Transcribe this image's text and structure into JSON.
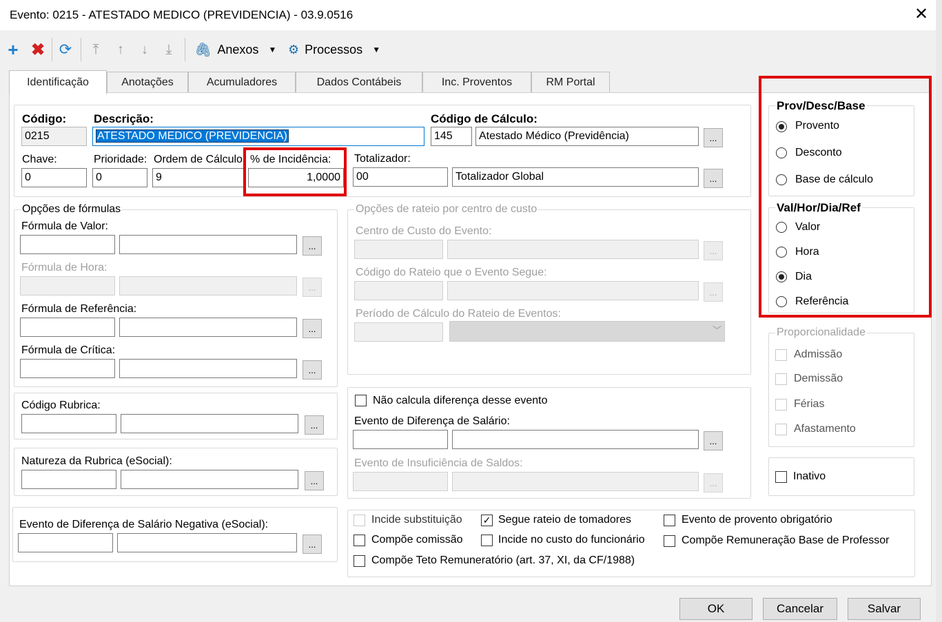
{
  "window": {
    "title": "Evento: 0215 - ATESTADO MEDICO (PREVIDENCIA) - 03.9.0516"
  },
  "toolbar": {
    "anexos": "Anexos",
    "processos": "Processos"
  },
  "tabs": [
    "Identificação",
    "Anotações",
    "Acumuladores",
    "Dados Contábeis",
    "Inc. Proventos",
    "RM Portal"
  ],
  "ident": {
    "codigo_label": "Código:",
    "codigo": "0215",
    "descricao_label": "Descrição:",
    "descricao": "ATESTADO MEDICO (PREVIDENCIA)",
    "codcalc_label": "Código de Cálculo:",
    "codcalc": "145",
    "codcalc_desc": "Atestado Médico (Previdência)",
    "chave_label": "Chave:",
    "chave": "0",
    "prioridade_label": "Prioridade:",
    "prioridade": "0",
    "ordem_label": "Ordem de Cálculo:",
    "ordem": "9",
    "incidencia_label": "% de Incidência:",
    "incidencia": "1,0000",
    "totalizador_label": "Totalizador:",
    "totalizador": "00",
    "totalizador_desc": "Totalizador Global"
  },
  "formulas": {
    "legend": "Opções de fórmulas",
    "valor": "Fórmula de Valor:",
    "hora": "Fórmula de Hora:",
    "referencia": "Fórmula de Referência:",
    "critica": "Fórmula de Crítica:"
  },
  "rubrica": {
    "codigo": "Código Rubrica:",
    "natureza": "Natureza da Rubrica (eSocial):"
  },
  "negativa": {
    "label": "Evento de Diferença de Salário Negativa (eSocial):"
  },
  "rateio": {
    "legend": "Opções de rateio por centro de custo",
    "centro": "Centro de Custo do Evento:",
    "codigo": "Código do Rateio que o Evento Segue:",
    "periodo": "Período de Cálculo do Rateio de Eventos:"
  },
  "diferenca": {
    "nao_calcula": "Não calcula diferença desse evento",
    "evento_dif": "Evento de Diferença de Salário:",
    "insuficiencia": "Evento de Insuficiência de Saldos:"
  },
  "checks": {
    "incide_subst": "Incide substituição",
    "segue_rateio": "Segue rateio de tomadores",
    "evento_obrig": "Evento de provento obrigatório",
    "compoe_comissao": "Compõe comissão",
    "incide_custo": "Incide no custo do funcionário",
    "compoe_remun": "Compõe Remuneração Base de Professor",
    "compoe_teto": "Compõe Teto Remuneratório (art. 37, XI, da CF/1988)"
  },
  "provdesc": {
    "legend": "Prov/Desc/Base",
    "options": [
      "Provento",
      "Desconto",
      "Base de cálculo"
    ],
    "selected": 0
  },
  "valhor": {
    "legend": "Val/Hor/Dia/Ref",
    "options": [
      "Valor",
      "Hora",
      "Dia",
      "Referência"
    ],
    "selected": 2
  },
  "proporcionalidade": {
    "legend": "Proporcionalidade",
    "options": [
      "Admissão",
      "Demissão",
      "Férias",
      "Afastamento"
    ]
  },
  "inativo": "Inativo",
  "buttons": {
    "ok": "OK",
    "cancelar": "Cancelar",
    "salvar": "Salvar"
  },
  "colors": {
    "highlight": "#e00000",
    "selection": "#0078d7",
    "add_icon": "#1a7fd0",
    "delete_icon": "#d32020"
  }
}
